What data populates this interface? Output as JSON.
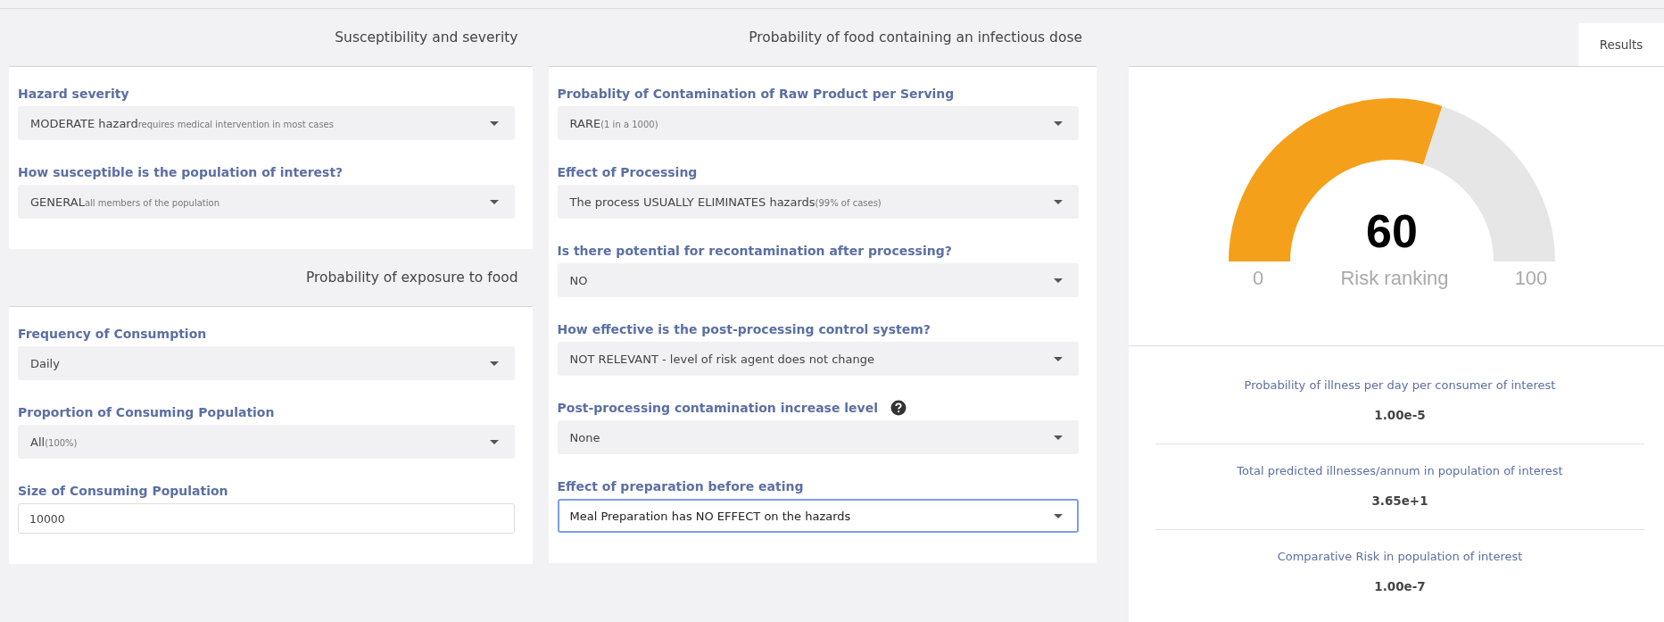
{
  "columns": [
    {
      "sections": [
        {
          "title": "Susceptibility and severity",
          "fields": [
            {
              "kind": "select",
              "label": "Hazard severity",
              "value": "MODERATE hazard",
              "note": "requires medical intervention in most cases",
              "help": false,
              "focused": false
            },
            {
              "kind": "select",
              "label": "How susceptible is the population of interest?",
              "value": "GENERAL",
              "note": "all members of the population",
              "help": false,
              "focused": false
            }
          ]
        },
        {
          "title": "Probability of exposure to food",
          "fields": [
            {
              "kind": "select",
              "label": "Frequency of Consumption",
              "value": "Daily",
              "help": false,
              "focused": false
            },
            {
              "kind": "select",
              "label": "Proportion of Consuming Population",
              "value": "All",
              "note": "(100%)",
              "help": false,
              "focused": false
            },
            {
              "kind": "input",
              "label": "Size of Consuming Population",
              "value": "10000",
              "help": false,
              "focused": false
            }
          ]
        }
      ]
    },
    {
      "sections": [
        {
          "title": "Probability of food containing an infectious dose",
          "fields": [
            {
              "kind": "select",
              "label": "Probablity of Contamination of Raw Product per Serving",
              "value": "RARE",
              "note": "(1 in a 1000)",
              "help": false,
              "focused": false
            },
            {
              "kind": "select",
              "label": "Effect of Processing",
              "value": "The process USUALLY ELIMINATES hazards",
              "note": "(99% of cases)",
              "help": false,
              "focused": false
            },
            {
              "kind": "select",
              "label": "Is there potential for recontamination after processing?",
              "value": "NO",
              "help": false,
              "focused": false
            },
            {
              "kind": "select",
              "label": "How effective is the post-processing control system?",
              "value": "NOT RELEVANT - level of risk agent does not change",
              "help": false,
              "focused": false
            },
            {
              "kind": "select",
              "label": "Post-processing contamination increase level",
              "value": "None",
              "help": true,
              "focused": false
            },
            {
              "kind": "select",
              "label": "Effect of preparation before eating",
              "value": "Meal Preparation has NO EFFECT on the hazards",
              "help": false,
              "focused": true
            }
          ]
        }
      ]
    }
  ],
  "results": {
    "tab": {
      "label": "Results",
      "selected": true
    },
    "gauge": {
      "value": "60",
      "min": "0",
      "max": "100",
      "label": "Risk ranking"
    },
    "metrics": [
      {
        "label": "Probability of illness per day per consumer of interest",
        "value": "1.00e-5"
      },
      {
        "label": "Total predicted illnesses/annum in population of interest",
        "value": "3.65e+1"
      },
      {
        "label": "Comparative Risk in population of interest",
        "value": "1.00e-7"
      }
    ]
  }
}
